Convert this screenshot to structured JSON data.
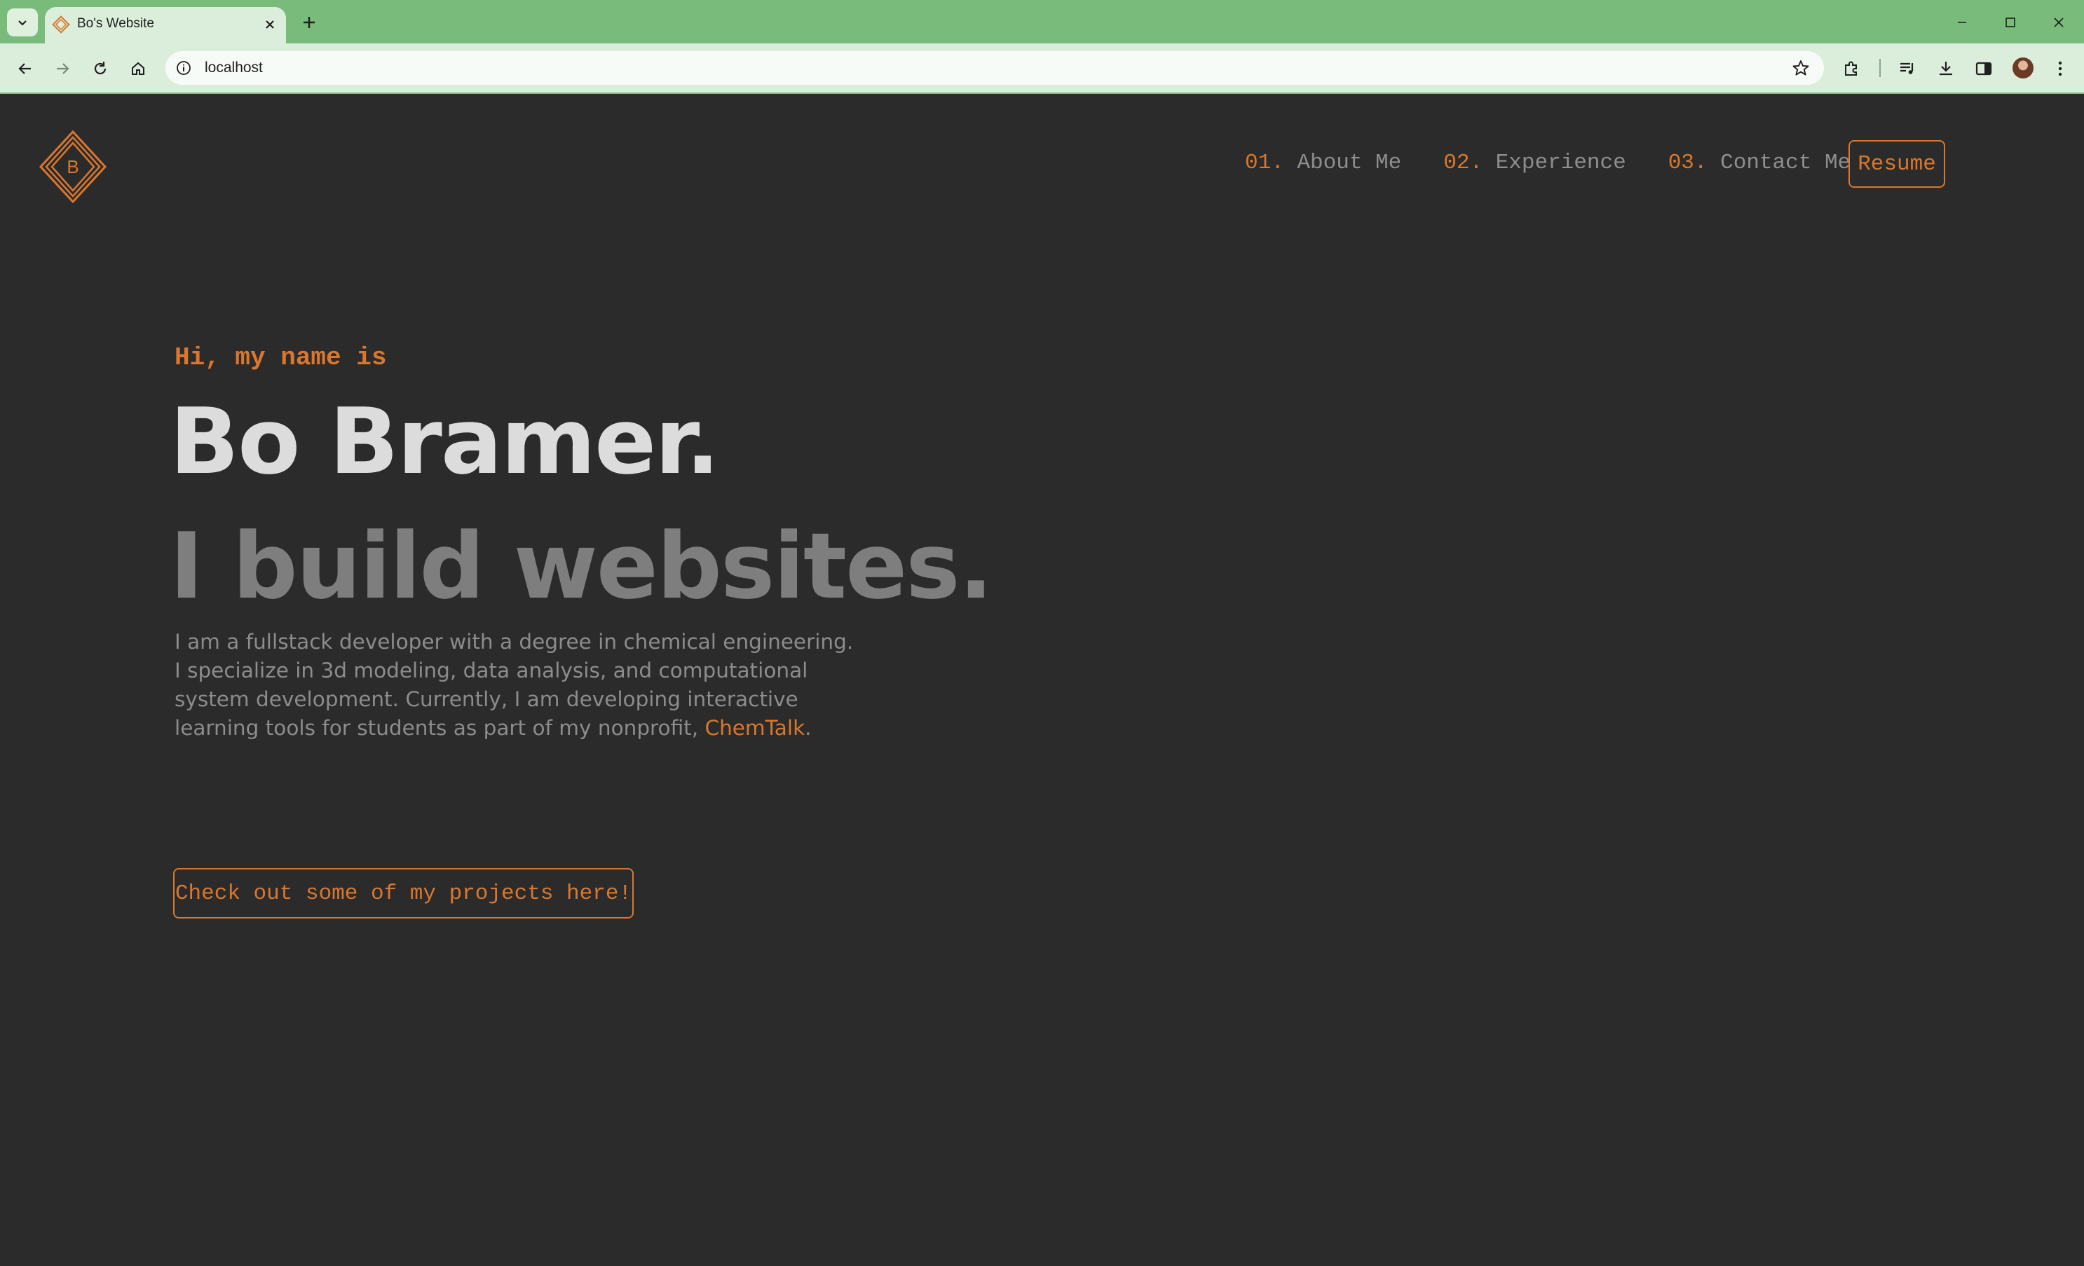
{
  "browser": {
    "tab_title": "Bo's Website",
    "url": "localhost",
    "theme_color": "#79bb7b"
  },
  "logo": {
    "letter": "B"
  },
  "nav": {
    "items": [
      {
        "number": "01.",
        "label": "About Me"
      },
      {
        "number": "02.",
        "label": "Experience"
      },
      {
        "number": "03.",
        "label": "Contact Me"
      }
    ],
    "resume_label": "Resume"
  },
  "hero": {
    "greeting": "Hi, my name is",
    "name": "Bo Bramer.",
    "tagline": "I build websites.",
    "bio_text": "I am a fullstack developer with a degree in chemical engineering. I specialize in 3d modeling, data analysis, and computational system development. Currently, I am developing interactive learning tools for students as part of my nonprofit,",
    "bio_link": "ChemTalk",
    "bio_end": ".",
    "cta_label": "Check out some of my projects here!"
  },
  "colors": {
    "accent": "#d9772f",
    "background": "#2b2b2b",
    "heading": "#dcdcdc",
    "muted": "#7e7e7e"
  }
}
